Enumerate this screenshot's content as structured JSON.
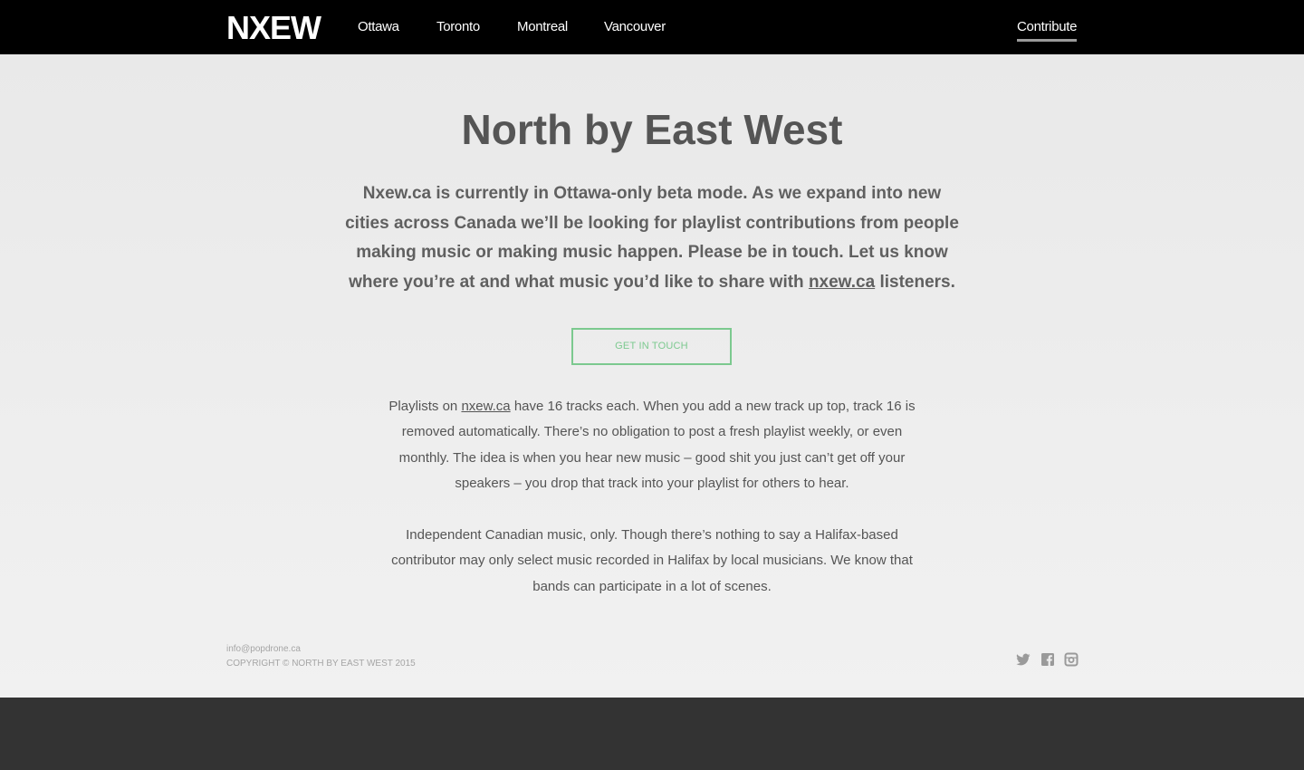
{
  "header": {
    "logo": "NXEW",
    "nav": [
      {
        "label": "Ottawa"
      },
      {
        "label": "Toronto"
      },
      {
        "label": "Montreal"
      },
      {
        "label": "Vancouver"
      }
    ],
    "contribute_label": "Contribute"
  },
  "main": {
    "title": "North by East West",
    "lead_before_link": "Nxew.ca is currently in Ottawa-only beta mode. As we expand into new cities across Canada we’ll be looking for playlist contributions from people making music or making music happen. Please be in touch. Let us know where you’re at and what music you’d like to share with ",
    "lead_link": "nxew.ca",
    "lead_after_link": " listeners.",
    "cta_label": "GET IN TOUCH",
    "p1_before_link": "Playlists on ",
    "p1_link": "nxew.ca",
    "p1_after_link": " have 16 tracks each. When you add a new track up top, track 16 is removed automatically. There’s no obligation to post a fresh playlist weekly, or even monthly. The idea is when you hear new music – good shit you just can’t get off your speakers – you drop that track into your playlist for others to hear.",
    "p2": "Independent Canadian music, only. Though there’s nothing to say a Halifax-based contributor may only select music recorded in Halifax by local musicians. We know that bands can participate in a lot of scenes."
  },
  "footer": {
    "email": "info@popdrone.ca",
    "copyright": "COPYRIGHT © NORTH BY EAST WEST 2015",
    "social": [
      {
        "icon": "twitter-icon"
      },
      {
        "icon": "facebook-icon"
      },
      {
        "icon": "instagram-icon"
      }
    ]
  },
  "colors": {
    "topbar": "#000000",
    "accent_green": "#7cc98f",
    "text_gray": "#555555",
    "bottom_band": "#333333"
  }
}
